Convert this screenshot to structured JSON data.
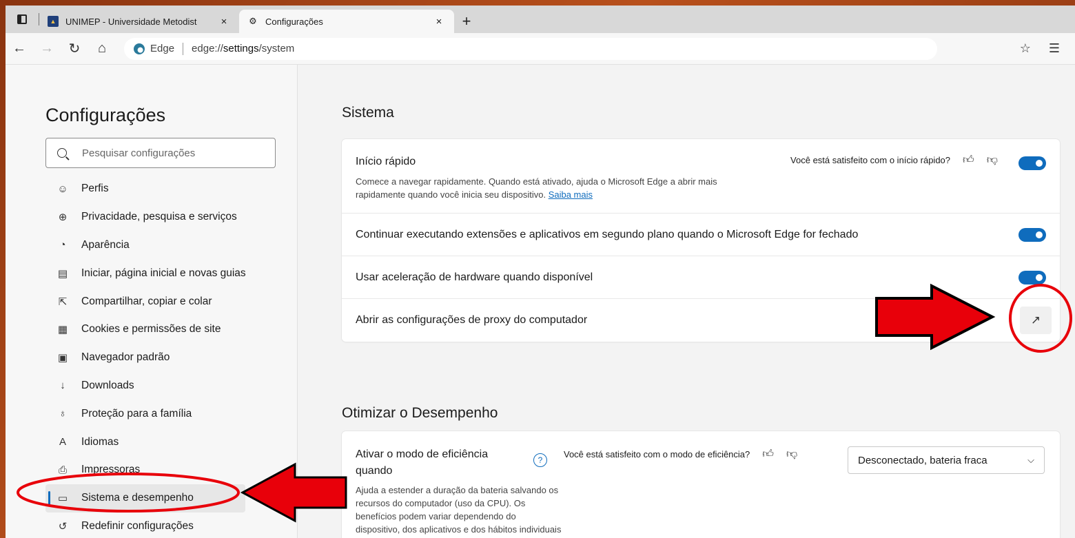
{
  "tabs": [
    {
      "label": "UNIMEP - Universidade Metodist",
      "favicon": "unimep-logo",
      "close": "×",
      "active": false
    },
    {
      "label": "Configurações",
      "favicon": "gear-icon",
      "close": "×",
      "active": true
    }
  ],
  "new_tab_symbol": "+",
  "address": {
    "site_label": "Edge",
    "url_prefix": "edge://",
    "url_bold": "settings",
    "url_suffix": "/system"
  },
  "sidebar": {
    "title": "Configurações",
    "search_placeholder": "Pesquisar configurações",
    "items": [
      {
        "label": "Perfis",
        "icon": "profile-icon",
        "glyph": "☺"
      },
      {
        "label": "Privacidade, pesquisa e serviços",
        "icon": "lock-icon",
        "glyph": "🔒︎"
      },
      {
        "label": "Aparência",
        "icon": "palette-icon",
        "glyph": "◔"
      },
      {
        "label": "Iniciar, página inicial e novas guias",
        "icon": "start-page-icon",
        "glyph": "▤"
      },
      {
        "label": "Compartilhar, copiar e colar",
        "icon": "share-icon",
        "glyph": "⇱"
      },
      {
        "label": "Cookies e permissões de site",
        "icon": "cookies-icon",
        "glyph": "▦"
      },
      {
        "label": "Navegador padrão",
        "icon": "default-browser-icon",
        "glyph": "▣"
      },
      {
        "label": "Downloads",
        "icon": "download-icon",
        "glyph": "↓"
      },
      {
        "label": "Proteção para a família",
        "icon": "family-icon",
        "glyph": "♁"
      },
      {
        "label": "Idiomas",
        "icon": "language-icon",
        "glyph": "A"
      },
      {
        "label": "Impressoras",
        "icon": "printer-icon",
        "glyph": "⎙"
      },
      {
        "label": "Sistema e desempenho",
        "icon": "laptop-icon",
        "glyph": "▭",
        "selected": true
      },
      {
        "label": "Redefinir configurações",
        "icon": "reset-icon",
        "glyph": "↺"
      }
    ]
  },
  "sistema": {
    "title": "Sistema",
    "rows": [
      {
        "title": "Início rápido",
        "desc": "Comece a navegar rapidamente. Quando está ativado, ajuda o Microsoft Edge a abrir mais rapidamente quando você inicia seu dispositivo.",
        "link": "Saiba mais",
        "feedback": "Você está satisfeito com o início rápido?",
        "toggle": "on"
      },
      {
        "title": "Continuar executando extensões e aplicativos em segundo plano quando o Microsoft Edge for fechado",
        "toggle": "on"
      },
      {
        "title": "Usar aceleração de hardware quando disponível",
        "toggle": "on"
      },
      {
        "title": "Abrir as configurações de proxy do computador",
        "action_icon": "external-link-icon"
      }
    ]
  },
  "desempenho": {
    "title": "Otimizar o Desempenho",
    "row": {
      "title": "Ativar o modo de eficiência quando",
      "help_symbol": "?",
      "feedback": "Você está satisfeito com o modo de eficiência?",
      "select_value": "Desconectado, bateria fraca",
      "desc": "Ajuda a estender a duração da bateria salvando os recursos do computador (uso da CPU). Os benefícios podem variar dependendo do dispositivo, dos aplicativos e dos hábitos individuais do"
    }
  },
  "colors": {
    "accent": "#0f6cbd",
    "annotation_red": "#e8000a",
    "background": "#b8501c"
  }
}
